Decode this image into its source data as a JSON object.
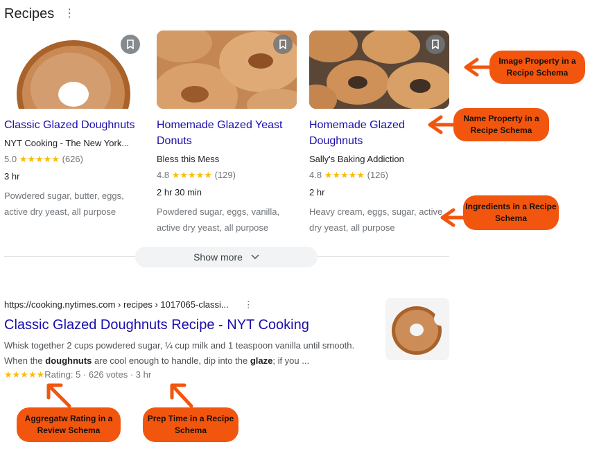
{
  "header": {
    "title": "Recipes",
    "menu_icon": "vertical-dots-icon"
  },
  "cards": [
    {
      "title": "Classic Glazed Doughnuts",
      "source": "NYT Cooking - The New York...",
      "rating": "5.0",
      "stars": "★★★★★",
      "votes": "(626)",
      "time": "3 hr",
      "ingredients": "Powdered sugar, butter, eggs, active dry yeast, all purpose"
    },
    {
      "title": "Homemade Glazed Yeast Donuts",
      "source": "Bless this Mess",
      "rating": "4.8",
      "stars": "★★★★★",
      "votes": "(129)",
      "time": "2 hr 30 min",
      "ingredients": "Powdered sugar, eggs, vanilla, active dry yeast, all purpose"
    },
    {
      "title": "Homemade Glazed Doughnuts",
      "source": "Sally's Baking Addiction",
      "rating": "4.8",
      "stars": "★★★★★",
      "votes": "(126)",
      "time": "2 hr",
      "ingredients": "Heavy cream, eggs, sugar, active dry yeast, all purpose"
    }
  ],
  "show_more": {
    "label": "Show more"
  },
  "result": {
    "url": "https://cooking.nytimes.com › recipes › 1017065-classi...",
    "title": "Classic Glazed Doughnuts Recipe - NYT Cooking",
    "snippet_1": "Whisk together 2 cups powdered sugar, ¼ cup milk and 1 teaspoon vanilla until smooth. When the ",
    "snippet_bold_1": "doughnuts",
    "snippet_2": " are cool enough to handle, dip into the ",
    "snippet_bold_2": "glaze",
    "snippet_3": "; if you ...",
    "stars": "★★★★★",
    "rating_text": "Rating: 5 · 626 votes · 3 hr"
  },
  "callouts": {
    "image": "Image Property in a Recipe Schema",
    "name": "Name Property in a Recipe Schema",
    "ingredients": "Ingredients in a Recipe Schema",
    "aggregate": "Aggregatw Rating in a Review Schema",
    "prep": "Prep Time in a Recipe Schema"
  },
  "colors": {
    "link": "#1a0dab",
    "star": "#fbbc04",
    "callout": "#f2560e"
  }
}
